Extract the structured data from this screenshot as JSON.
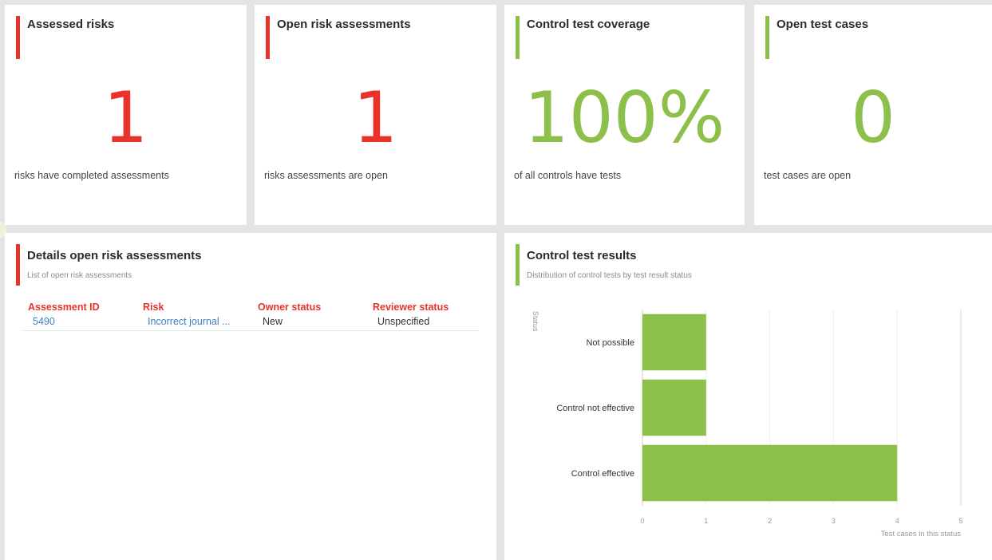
{
  "kpis": [
    {
      "title": "Assessed risks",
      "value": "1",
      "caption": "risks have completed assessments",
      "color": "#e8332a"
    },
    {
      "title": "Open risk assessments",
      "value": "1",
      "caption": "risks assessments are open",
      "color": "#e8332a"
    },
    {
      "title": "Control test coverage",
      "value": "100%",
      "caption": "of all controls have tests",
      "color": "#8cc04b"
    },
    {
      "title": "Open test cases",
      "value": "0",
      "caption": "test cases are open",
      "color": "#8cc04b"
    }
  ],
  "details": {
    "title": "Details open risk assessments",
    "subtitle": "List of open risk assessments",
    "columns": [
      "Assessment ID",
      "Risk",
      "Owner status",
      "Reviewer status"
    ],
    "rows": [
      {
        "id": "5490",
        "risk": "Incorrect journal ...",
        "owner_status": "New",
        "reviewer_status": "Unspecified"
      }
    ]
  },
  "results": {
    "title": "Control test results",
    "subtitle": "Distribution of control tests by test result status"
  },
  "chart_data": {
    "type": "bar",
    "orientation": "horizontal",
    "categories": [
      "Not possible",
      "Control not effective",
      "Control effective"
    ],
    "values": [
      1,
      1,
      4
    ],
    "xlabel": "Test cases in this status",
    "ylabel": "Status",
    "xlim": [
      0,
      5
    ],
    "xticks": [
      "0",
      "1",
      "2",
      "3",
      "4",
      "5"
    ],
    "bar_color": "#8cc04b",
    "grid": true
  }
}
